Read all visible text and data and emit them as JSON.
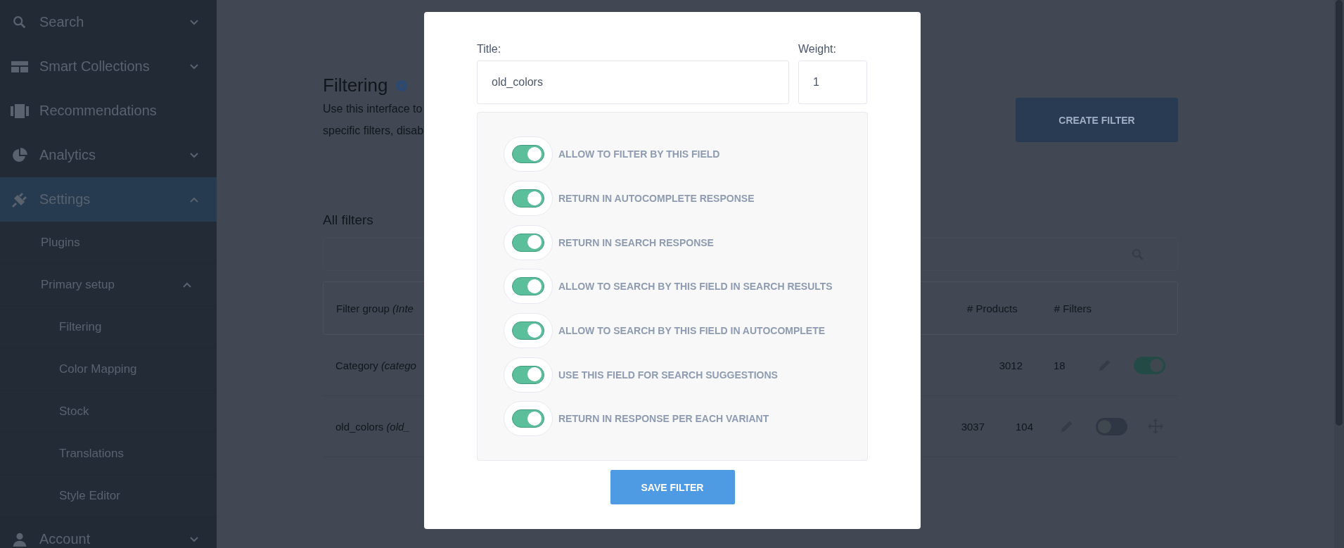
{
  "sidebar": {
    "items": [
      {
        "label": "Search",
        "selected": false,
        "expanded": false
      },
      {
        "label": "Smart Collections",
        "selected": false,
        "expanded": false
      },
      {
        "label": "Recommendations",
        "selected": false
      },
      {
        "label": "Analytics",
        "selected": false,
        "expanded": false
      },
      {
        "label": "Settings",
        "selected": true,
        "expanded": true,
        "children": [
          {
            "label": "Plugins",
            "selected": false
          },
          {
            "label": "Primary setup",
            "selected": false,
            "expanded": true,
            "children": [
              {
                "label": "Filtering",
                "selected": false
              },
              {
                "label": "Color Mapping",
                "selected": false
              },
              {
                "label": "Stock",
                "selected": false
              },
              {
                "label": "Translations",
                "selected": false
              },
              {
                "label": "Style Editor",
                "selected": false
              }
            ]
          }
        ]
      },
      {
        "label": "Account",
        "selected": false,
        "expanded": false
      }
    ]
  },
  "page": {
    "title": "Filtering",
    "description": [
      "Use this interface to",
      "specific filters, disab"
    ],
    "create_button": "CREATE FILTER",
    "section_title": "All filters",
    "table": {
      "columns": [
        {
          "label": "Filter group",
          "hint": "(Inte"
        },
        {
          "label": "# Products"
        },
        {
          "label": "# Filters"
        }
      ],
      "rows": [
        {
          "name": "Category",
          "key": "(catego",
          "products": "3012",
          "filters": "18",
          "on": true,
          "movable": false
        },
        {
          "name": "old_colors",
          "key": "(old_",
          "products": "3037",
          "filters": "104",
          "on": false,
          "movable": true
        }
      ]
    }
  },
  "modal": {
    "title_field": {
      "label": "Title:",
      "value": "old_colors"
    },
    "weight_field": {
      "label": "Weight:",
      "value": "1"
    },
    "options": [
      {
        "label": "ALLOW TO FILTER BY THIS FIELD",
        "on": true
      },
      {
        "label": "RETURN IN AUTOCOMPLETE RESPONSE",
        "on": true
      },
      {
        "label": "RETURN IN SEARCH RESPONSE",
        "on": true
      },
      {
        "label": "ALLOW TO SEARCH BY THIS FIELD IN SEARCH RESULTS",
        "on": true
      },
      {
        "label": "ALLOW TO SEARCH BY THIS FIELD IN AUTOCOMPLETE",
        "on": true
      },
      {
        "label": "USE THIS FIELD FOR SEARCH SUGGESTIONS",
        "on": true
      },
      {
        "label": "RETURN IN RESPONSE PER EACH VARIANT",
        "on": true
      }
    ],
    "save_button": "SAVE FILTER"
  }
}
